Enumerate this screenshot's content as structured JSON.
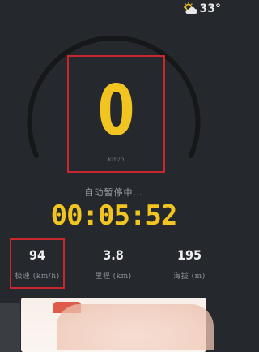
{
  "status": {
    "weather_icon": "partly-cloudy-icon",
    "temperature": "33°"
  },
  "speed": {
    "value": "0",
    "unit": "km/h"
  },
  "pause_text": "自动暂停中…",
  "timer": "00:05:52",
  "stats": [
    {
      "value": "94",
      "label": "极速 (km/h)"
    },
    {
      "value": "3.8",
      "label": "里程 (km)"
    },
    {
      "value": "195",
      "label": "海拔 (m)"
    }
  ],
  "colors": {
    "background": "#25282d",
    "accent": "#f2c422",
    "highlight_box": "#c8282d"
  }
}
